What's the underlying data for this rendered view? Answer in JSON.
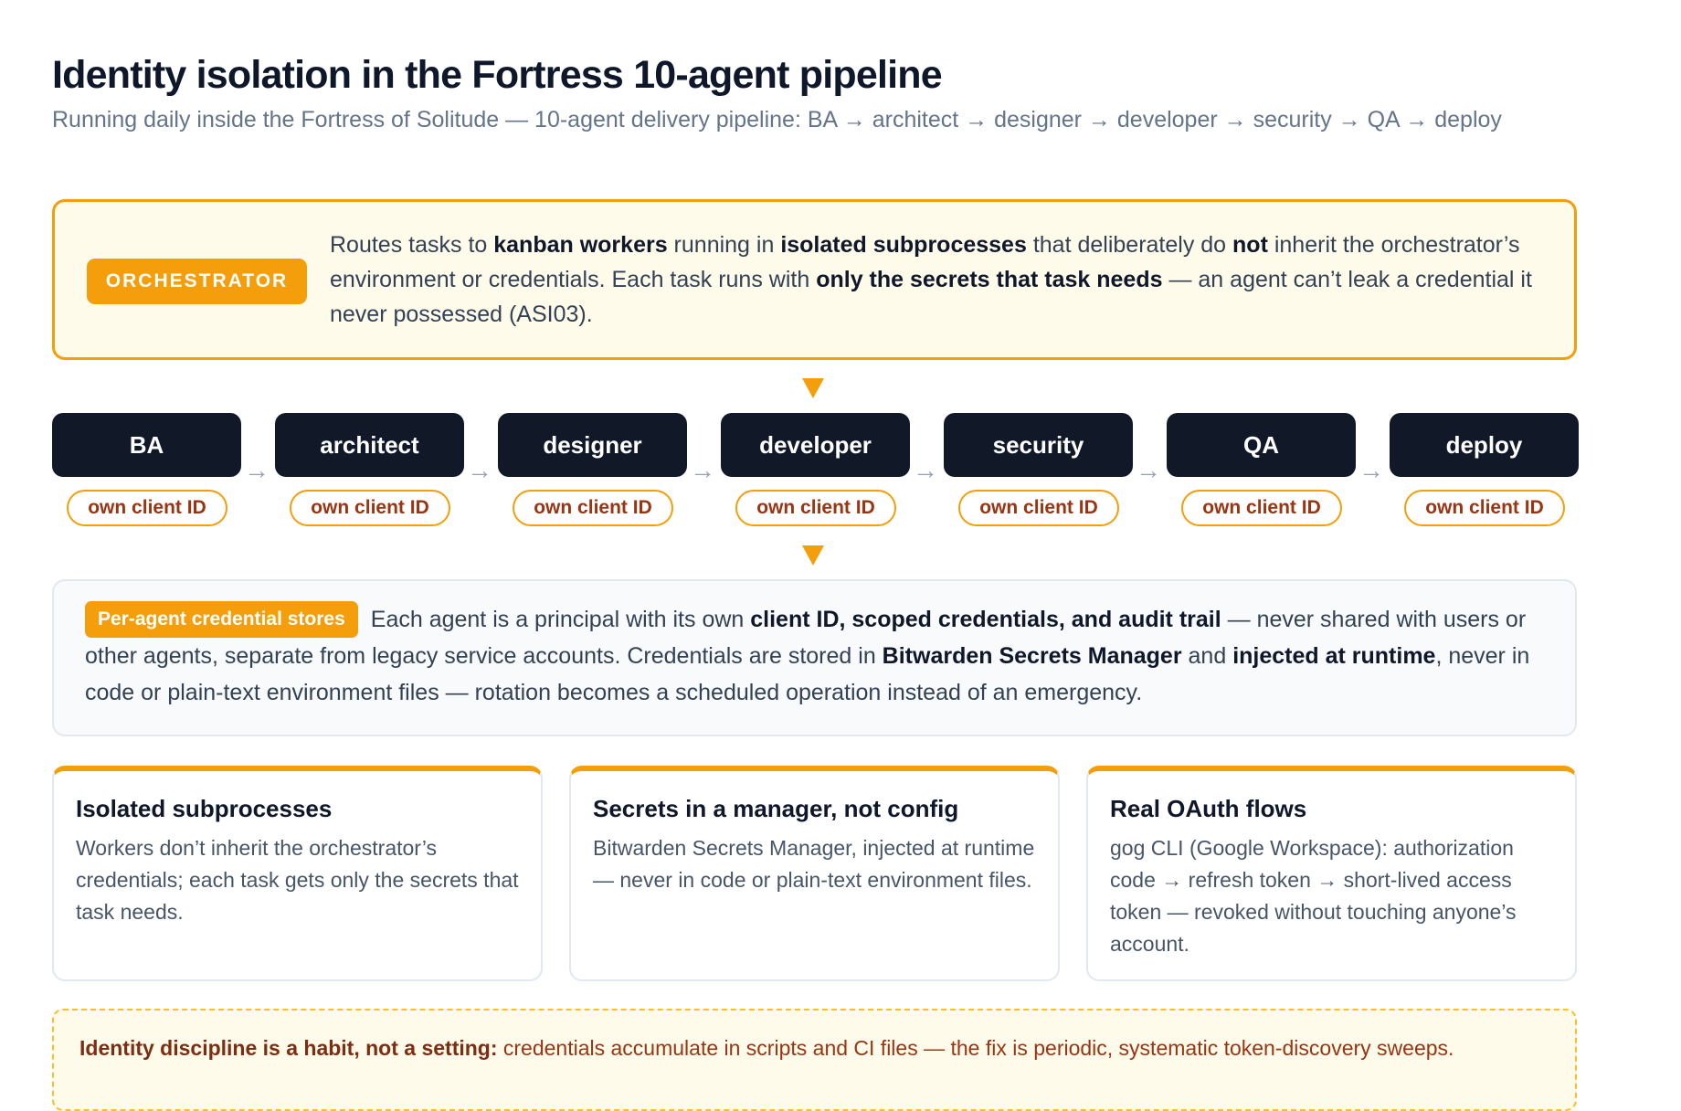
{
  "header": {
    "title": "Identity isolation in the Fortress 10-agent pipeline",
    "subtitle": "Running daily inside the Fortress of Solitude — 10-agent delivery pipeline: BA → architect → designer → developer → security → QA → deploy"
  },
  "orchestrator": {
    "badge": "ORCHESTRATOR",
    "text": [
      {
        "t": "Routes tasks to ",
        "b": false
      },
      {
        "t": "kanban workers",
        "b": true
      },
      {
        "t": " running in ",
        "b": false
      },
      {
        "t": "isolated subprocesses",
        "b": true
      },
      {
        "t": " that deliberately do ",
        "b": false
      },
      {
        "t": "not",
        "b": true
      },
      {
        "t": " inherit the orchestrator’s environment or credentials. Each task runs with ",
        "b": false
      },
      {
        "t": "only the secrets that task needs",
        "b": true
      },
      {
        "t": " — an agent can’t leak a credential it never possessed (ASI03).",
        "b": false
      }
    ]
  },
  "pipeline": {
    "stages": [
      {
        "name": "BA",
        "tag": "own client ID"
      },
      {
        "name": "architect",
        "tag": "own client ID"
      },
      {
        "name": "designer",
        "tag": "own client ID"
      },
      {
        "name": "developer",
        "tag": "own client ID"
      },
      {
        "name": "security",
        "tag": "own client ID"
      },
      {
        "name": "QA",
        "tag": "own client ID"
      },
      {
        "name": "deploy",
        "tag": "own client ID"
      }
    ],
    "arrow_glyph": "→"
  },
  "stores": {
    "badge": "Per-agent credential stores",
    "text": [
      {
        "t": "Each agent is a principal with its own ",
        "b": false
      },
      {
        "t": "client ID, scoped credentials, and audit trail",
        "b": true
      },
      {
        "t": " — never shared with users or other agents, separate from legacy service accounts. Credentials are stored in ",
        "b": false
      },
      {
        "t": "Bitwarden Secrets Manager",
        "b": true
      },
      {
        "t": " and ",
        "b": false
      },
      {
        "t": "injected at runtime",
        "b": true
      },
      {
        "t": ", never in code or plain-text environment files — rotation becomes a scheduled operation instead of an emergency.",
        "b": false
      }
    ]
  },
  "cards": [
    {
      "title": "Isolated subprocesses",
      "body": "Workers don’t inherit the orchestrator’s credentials; each task gets only the secrets that task needs."
    },
    {
      "title": "Secrets in a manager, not config",
      "body": "Bitwarden Secrets Manager, injected at runtime — never in code or plain-text environment files."
    },
    {
      "title": "Real OAuth flows",
      "body": "gog CLI (Google Workspace): authorization code → refresh token → short-lived access token — revoked without touching anyone’s account."
    }
  ],
  "note": {
    "lead": "Identity discipline is a habit, not a setting:",
    "text": " credentials accumulate in scripts and CI files — the fix is periodic, systematic token-discovery sweeps."
  },
  "colors": {
    "accent": "#f59e0b",
    "stage_bg": "#111827",
    "tag_text": "#9a3412"
  }
}
